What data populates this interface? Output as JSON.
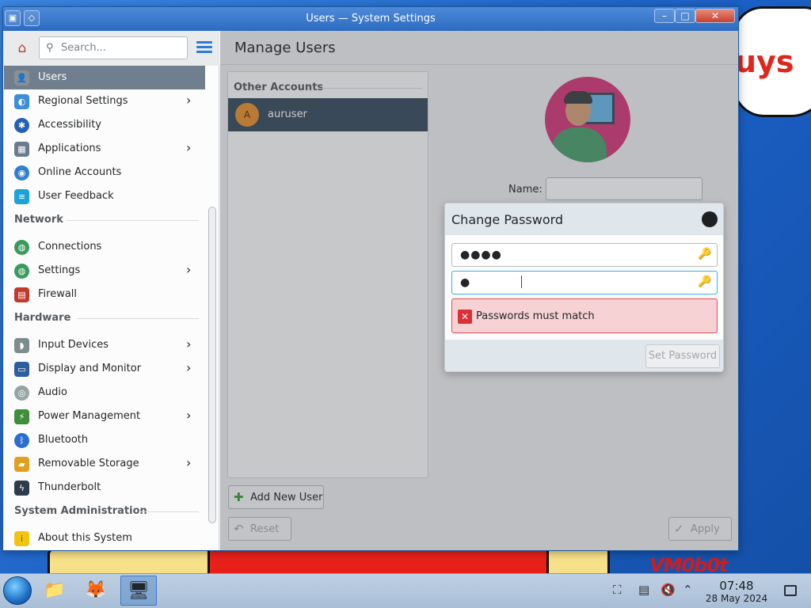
{
  "window": {
    "title": "Users — System Settings"
  },
  "sidebar": {
    "search_placeholder": "Search...",
    "items_top": [
      {
        "label": "Users",
        "icon": "users-icon",
        "color": "#8a8f94",
        "active": true,
        "chevron": false
      },
      {
        "label": "Regional Settings",
        "icon": "regional-settings-icon",
        "color": "#3c8fd8",
        "chevron": true
      },
      {
        "label": "Accessibility",
        "icon": "accessibility-icon",
        "color": "#2360b8",
        "chevron": false
      },
      {
        "label": "Applications",
        "icon": "applications-icon",
        "color": "#6b7b8c",
        "chevron": true
      },
      {
        "label": "Online Accounts",
        "icon": "online-accounts-icon",
        "color": "#2f7fd0",
        "chevron": false
      },
      {
        "label": "User Feedback",
        "icon": "user-feedback-icon",
        "color": "#1ba3d8",
        "chevron": false
      }
    ],
    "section_network": "Network",
    "items_network": [
      {
        "label": "Connections",
        "icon": "connections-icon",
        "color": "#3a9a5c",
        "chevron": false
      },
      {
        "label": "Settings",
        "icon": "network-settings-icon",
        "color": "#3a9a5c",
        "chevron": true
      },
      {
        "label": "Firewall",
        "icon": "firewall-icon",
        "color": "#c0392b",
        "chevron": false
      }
    ],
    "section_hardware": "Hardware",
    "items_hardware": [
      {
        "label": "Input Devices",
        "icon": "input-devices-icon",
        "color": "#7f8c8d",
        "chevron": true
      },
      {
        "label": "Display and Monitor",
        "icon": "display-monitor-icon",
        "color": "#2c5f9e",
        "chevron": true
      },
      {
        "label": "Audio",
        "icon": "audio-icon",
        "color": "#95a5a6",
        "chevron": false
      },
      {
        "label": "Power Management",
        "icon": "power-management-icon",
        "color": "#3f8e3a",
        "chevron": true
      },
      {
        "label": "Bluetooth",
        "icon": "bluetooth-icon",
        "color": "#2a6dd0",
        "chevron": false
      },
      {
        "label": "Removable Storage",
        "icon": "removable-storage-icon",
        "color": "#e0a020",
        "chevron": true
      },
      {
        "label": "Thunderbolt",
        "icon": "thunderbolt-icon",
        "color": "#2e3b4a",
        "chevron": false
      }
    ],
    "section_sysadmin": "System Administration",
    "items_sysadmin": [
      {
        "label": "About this System",
        "icon": "about-system-icon",
        "color": "#f1c40f",
        "chevron": false
      }
    ]
  },
  "main": {
    "title": "Manage Users",
    "accounts_header": "Other Accounts",
    "accounts": [
      {
        "initial": "A",
        "name": "auruser"
      }
    ],
    "add_user_label": "Add New User",
    "reset_label": "Reset",
    "apply_label": "Apply",
    "name_label": "Name:",
    "name_value": ""
  },
  "dialog": {
    "title": "Change Password",
    "password_dots": "●●●●",
    "confirm_dots": "●",
    "error_text": "Passwords must match",
    "set_password_label": "Set Password"
  },
  "wallpaper": {
    "cloud_text": "uys",
    "signature": "VM0b0t"
  },
  "taskbar": {
    "time": "07:48",
    "date": "28 May 2024"
  },
  "colors": {
    "active_item": "#6f7f8e",
    "selected_account": "#3a4d5e",
    "avatar_ring": "#d63a7c",
    "error_border": "#e24a51",
    "error_bg": "#f6d2d4",
    "accent_blue": "#2b7cd3"
  }
}
